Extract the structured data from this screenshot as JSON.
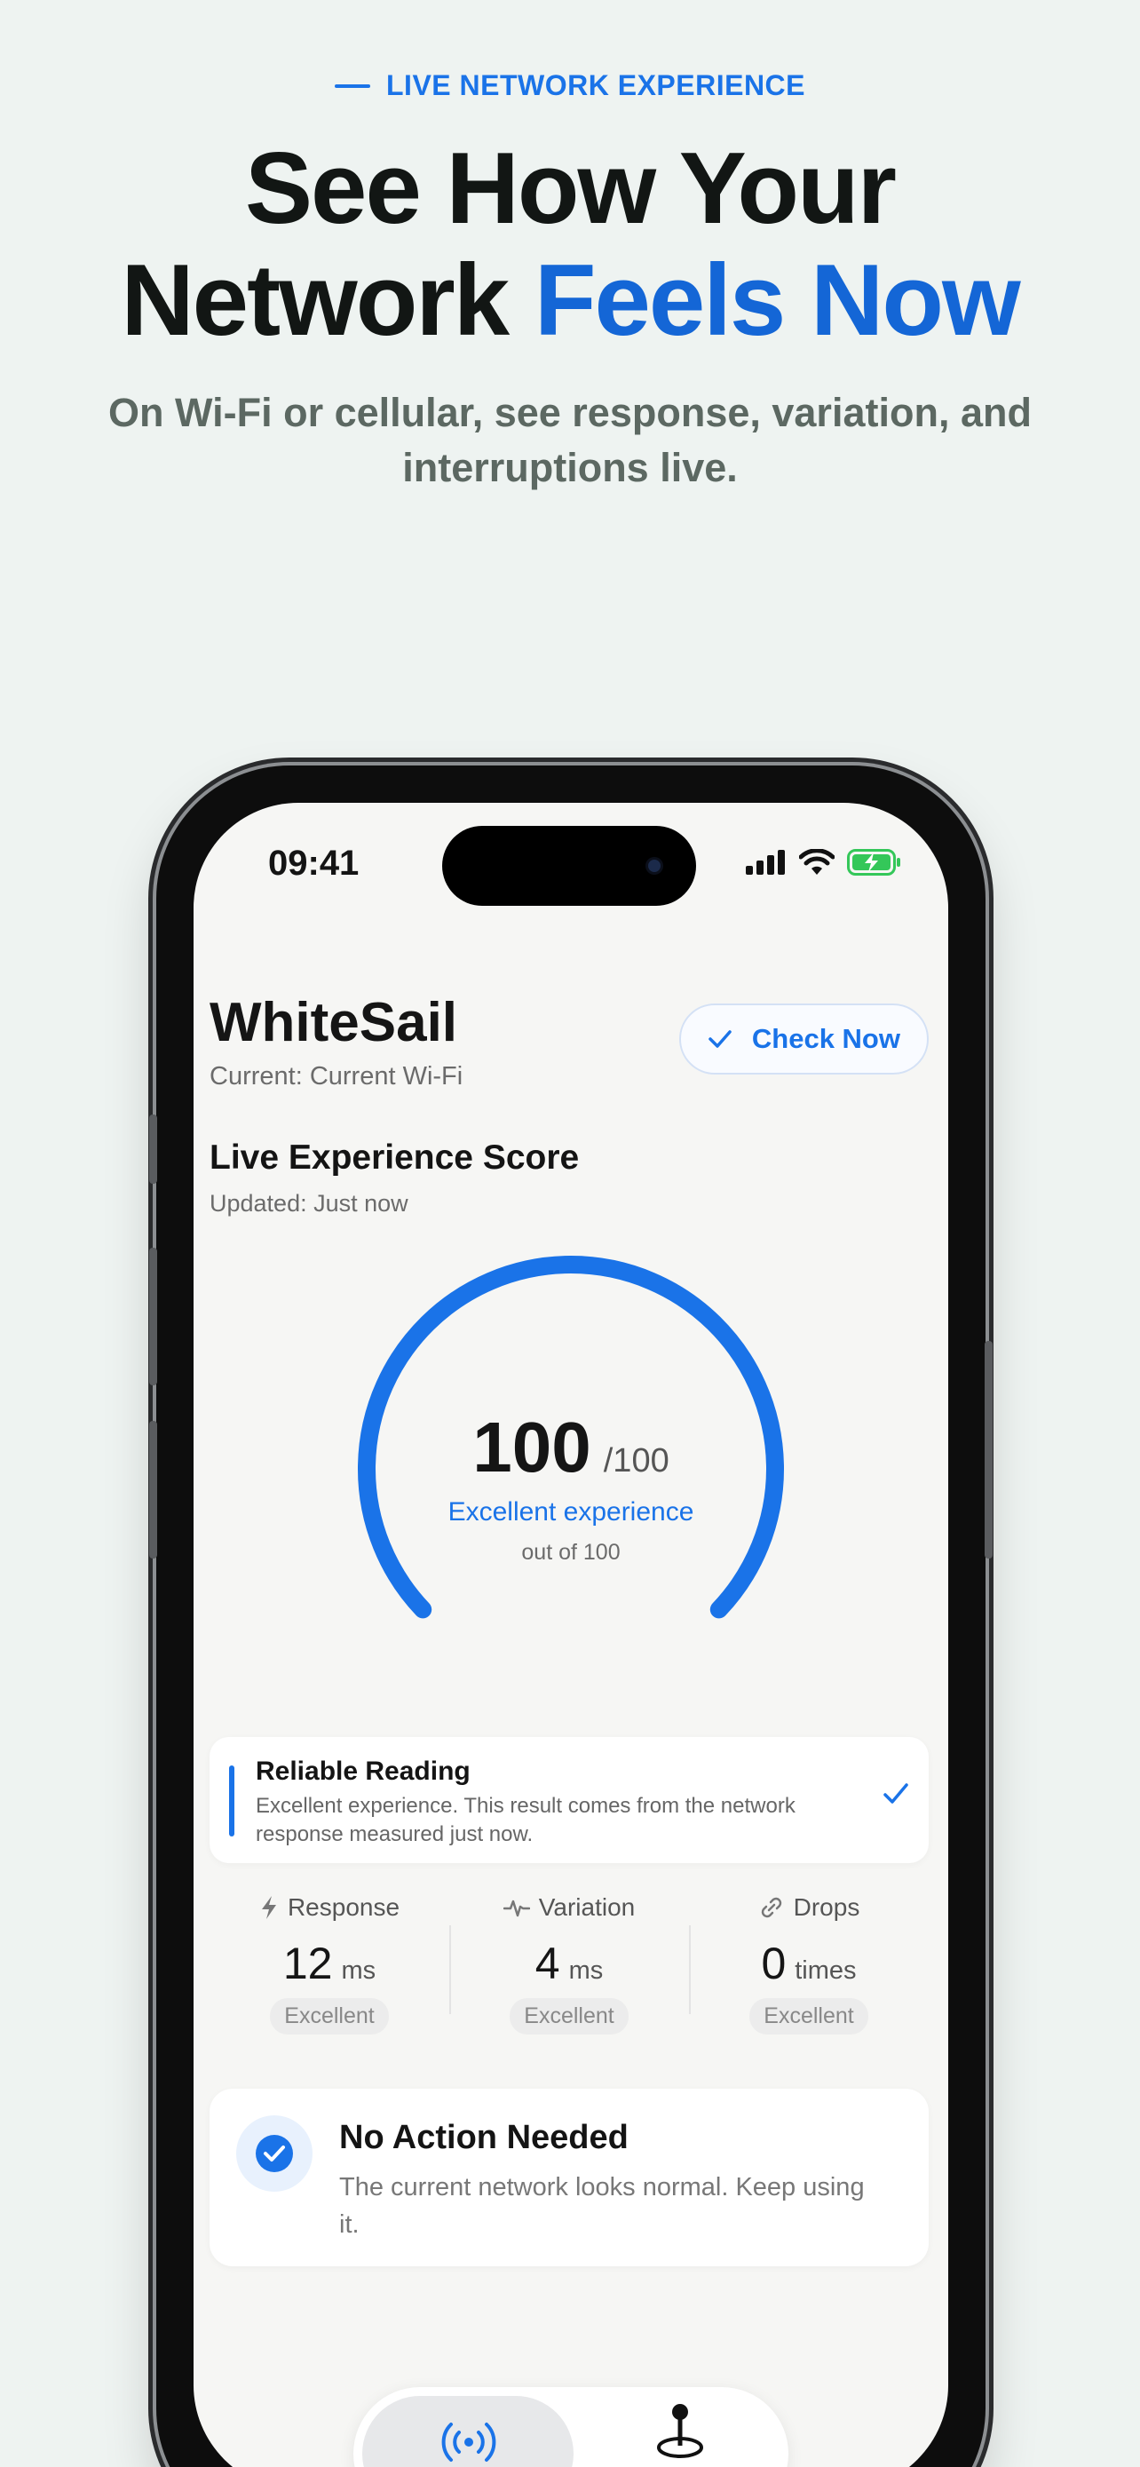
{
  "hero": {
    "eyebrow": "LIVE NETWORK EXPERIENCE",
    "headline_line1": "See How Your",
    "headline_line2_plain": "Network ",
    "headline_line2_accent": "Feels Now",
    "subhead": "On Wi-Fi or cellular, see response, variation, and interruptions live."
  },
  "status_bar": {
    "time": "09:41"
  },
  "app": {
    "title": "WhiteSail",
    "current_network": "Current: Current Wi-Fi",
    "check_button": "Check Now"
  },
  "score": {
    "title": "Live Experience Score",
    "updated": "Updated: Just now",
    "value": "100",
    "denominator": "/100",
    "label": "Excellent experience",
    "out_of": "out of 100",
    "fill_fraction": 1.0
  },
  "reliable": {
    "title": "Reliable Reading",
    "body": "Excellent experience. This result comes from the network response measured just now."
  },
  "metrics": [
    {
      "icon": "bolt-icon",
      "label": "Response",
      "value": "12",
      "unit": "ms",
      "rating": "Excellent"
    },
    {
      "icon": "pulse-icon",
      "label": "Variation",
      "value": "4",
      "unit": "ms",
      "rating": "Excellent"
    },
    {
      "icon": "link-icon",
      "label": "Drops",
      "value": "0",
      "unit": "times",
      "rating": "Excellent"
    }
  ],
  "action": {
    "title": "No Action Needed",
    "body": "The current network looks normal. Keep using it."
  },
  "colors": {
    "accent": "#1a73e8",
    "background": "#eef3f1",
    "battery_green": "#34c759"
  }
}
